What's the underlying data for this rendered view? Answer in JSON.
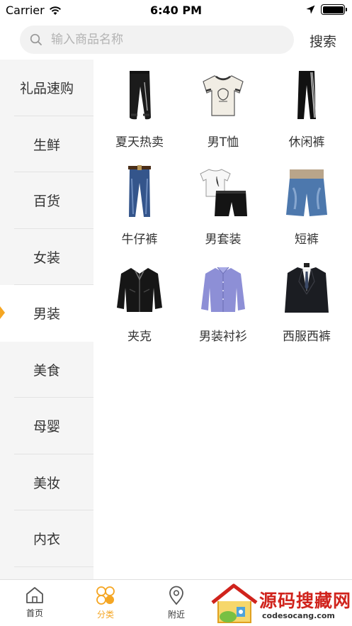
{
  "status_bar": {
    "carrier": "Carrier",
    "time": "6:40 PM"
  },
  "search": {
    "placeholder": "输入商品名称",
    "button_label": "搜索"
  },
  "sidebar": {
    "items": [
      {
        "label": "礼品速购"
      },
      {
        "label": "生鲜"
      },
      {
        "label": "百货"
      },
      {
        "label": "女装"
      },
      {
        "label": "男装",
        "active": true
      },
      {
        "label": "美食"
      },
      {
        "label": "母婴"
      },
      {
        "label": "美妆"
      },
      {
        "label": "内衣"
      }
    ]
  },
  "products": [
    {
      "label": "夏天热卖",
      "icon": "sweatpants-image"
    },
    {
      "label": "男T恤",
      "icon": "tshirt-image"
    },
    {
      "label": "休闲裤",
      "icon": "track-pants-image"
    },
    {
      "label": "牛仔裤",
      "icon": "jeans-image"
    },
    {
      "label": "男套装",
      "icon": "outfit-set-image"
    },
    {
      "label": "短裤",
      "icon": "shorts-image"
    },
    {
      "label": "夹克",
      "icon": "jacket-image"
    },
    {
      "label": "男装衬衫",
      "icon": "shirt-image"
    },
    {
      "label": "西服西裤",
      "icon": "suit-image"
    }
  ],
  "tabbar": {
    "home_label": "首页",
    "category_label": "分类",
    "nearby_label": "附近"
  },
  "watermark": {
    "title": "源码搜藏网",
    "subtitle": "codesocang.com"
  },
  "colors": {
    "accent": "#f5a623",
    "sidebar_bg": "#f5f5f5",
    "watermark_red": "#d0231c"
  }
}
